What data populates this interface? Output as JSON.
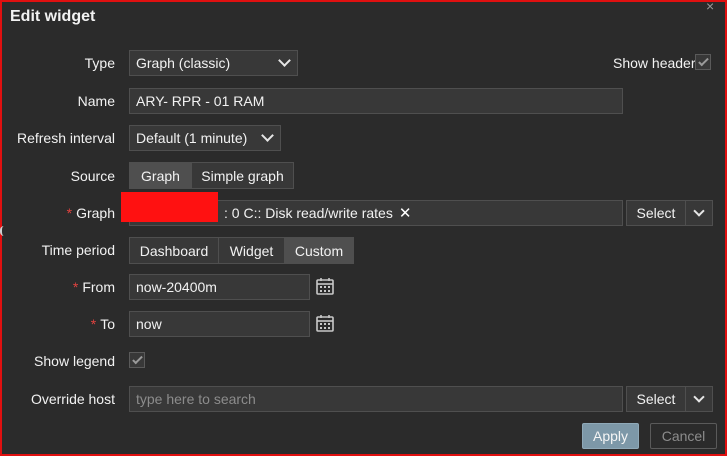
{
  "dialog": {
    "title": "Edit widget",
    "close_glyph": "×"
  },
  "form": {
    "type": {
      "label": "Type",
      "value": "Graph (classic)"
    },
    "show_header": {
      "label": "Show header",
      "checked": true
    },
    "name": {
      "label": "Name",
      "value": "ARY- RPR - 01 RAM"
    },
    "refresh": {
      "label": "Refresh interval",
      "value": "Default (1 minute)"
    },
    "source": {
      "label": "Source",
      "options": [
        "Graph",
        "Simple graph"
      ],
      "selected": "Graph"
    },
    "graph": {
      "required": "*",
      "label": "Graph",
      "chip_text": ": 0 C:: Disk read/write rates",
      "remove_glyph": "✕",
      "select_label": "Select"
    },
    "time_period": {
      "label": "Time period",
      "options": [
        "Dashboard",
        "Widget",
        "Custom"
      ],
      "selected": "Custom"
    },
    "from": {
      "required": "*",
      "label": "From",
      "value": "now-20400m"
    },
    "to": {
      "required": "*",
      "label": "To",
      "value": "now"
    },
    "show_legend": {
      "label": "Show legend",
      "checked": true
    },
    "override_host": {
      "label": "Override host",
      "placeholder": "type here to search",
      "select_label": "Select"
    }
  },
  "footer": {
    "apply": "Apply",
    "cancel": "Cancel"
  },
  "colors": {
    "background": "#2b2b2b",
    "input_bg": "#383838",
    "border": "#4f4f4f",
    "apply_bg": "#7d98a8",
    "required": "#e0423f",
    "highlight_frame": "#e01010"
  },
  "icons": {
    "close": "close-icon",
    "dropdown": "chevron-down-icon",
    "calendar": "calendar-icon",
    "check": "checkmark-icon",
    "remove": "remove-x-icon"
  }
}
